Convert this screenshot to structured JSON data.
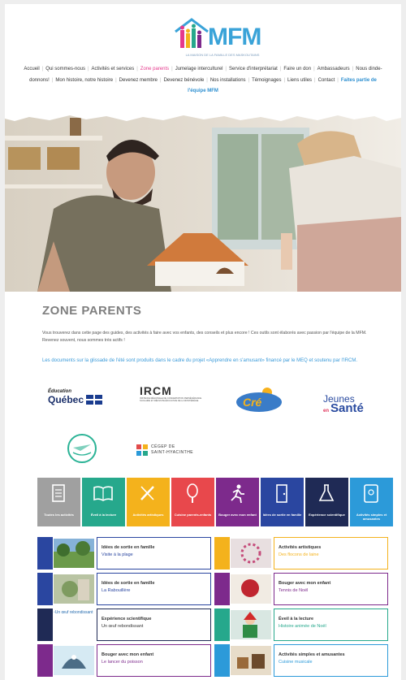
{
  "brand": {
    "logo_text": "MFM",
    "tagline": "LA MAISON DE LA FAMILLE DES MASKOUTAINS",
    "primary": "#3aa3d8",
    "accent": "#e5398c"
  },
  "nav": {
    "items": [
      {
        "label": "Accueil"
      },
      {
        "label": "Qui sommes-nous"
      },
      {
        "label": "Activités et services"
      },
      {
        "label": "Zone parents",
        "active": true
      },
      {
        "label": "Jumelage interculturel"
      },
      {
        "label": "Service d'interprétariat"
      },
      {
        "label": "Faire un don"
      },
      {
        "label": "Ambassadeurs"
      },
      {
        "label": "Nous dinde-donnons!"
      },
      {
        "label": "Mon histoire, notre histoire"
      },
      {
        "label": "Devenez membre"
      },
      {
        "label": "Devenez bénévole"
      },
      {
        "label": "Nos installations"
      },
      {
        "label": "Témoignages"
      },
      {
        "label": "Liens utiles"
      },
      {
        "label": "Contact"
      },
      {
        "label": "Faites partie de l'équipe MFM",
        "highlight": true
      }
    ]
  },
  "zone": {
    "title": "ZONE PARENTS",
    "intro": "Vous trouverez dans cette page des guides, des activités à faire avec vos enfants, des conseils et plus encore ! Ces outils sont élaborés avec passion par l'équipe de la MFM. Revenez souvent, nous sommes très actifs !",
    "docs_note": "Les documents sur la glissade de l'été sont produits dans le cadre du projet «Apprendre en s'amusant» financé par le MEQ et soutenu par l'IRCM."
  },
  "partners": {
    "quebec": {
      "top": "Éducation",
      "main": "Québec"
    },
    "ircm": {
      "name": "IRCM",
      "sub": "INSTANCE RÉGIONALE DE CONCERTATION PERSÉVÉRANCE SCOLAIRE ET RÉUSSITE ÉDUCATIVE DE LA MONTÉRÉGIE"
    },
    "cre": {
      "name": "Cré"
    },
    "jeunes": {
      "a": "Jeunes",
      "b": "en",
      "c": "Santé"
    },
    "cegep": {
      "l1": "CÉGEP DE",
      "l2": "SAINT-HYACINTHE"
    }
  },
  "categories": [
    {
      "label": "Toutes les activités",
      "color": "#a0a0a0",
      "icon": "list-document-icon"
    },
    {
      "label": "Éveil à la lecture",
      "color": "#26a88c",
      "icon": "open-book-icon"
    },
    {
      "label": "Activités artistiques",
      "color": "#f4b21c",
      "icon": "pencil-brush-icon"
    },
    {
      "label": "Cuisine parents-enfants",
      "color": "#e8484c",
      "icon": "whisk-icon"
    },
    {
      "label": "Bouger avec mon enfant",
      "color": "#7d2a8c",
      "icon": "running-person-icon"
    },
    {
      "label": "Idées de sortie en famille",
      "color": "#2a46a0",
      "icon": "door-icon"
    },
    {
      "label": "Expérience scientifique",
      "color": "#1f2a55",
      "icon": "flask-icon"
    },
    {
      "label": "Activités simples et amusantes",
      "color": "#2c9ad9",
      "icon": "tablet-icon"
    }
  ],
  "activities_left": [
    {
      "category": "Idées de sortie en famille",
      "title": "Visite à la plage",
      "color": "#2a46a0",
      "subcolor": "#2a46a0"
    },
    {
      "category": "Idées de sortie en famille",
      "title": "La Rabouillère",
      "color": "#2a46a0",
      "subcolor": "#2a46a0"
    },
    {
      "category": "Expérience scientifique",
      "title": "Un œuf rebondissant",
      "color": "#1f2a55",
      "subcolor": "#333",
      "thumb_alt": "Un œuf rebondissant"
    },
    {
      "category": "Bouger avec mon enfant",
      "title": "Le lancer du poisson",
      "color": "#7d2a8c",
      "subcolor": "#7d2a8c"
    }
  ],
  "activities_right": [
    {
      "category": "Activités artistiques",
      "title": "Des flocons de laine",
      "color": "#f4b21c",
      "subcolor": "#f4b21c"
    },
    {
      "category": "Bouger avec mon enfant",
      "title": "Tennis de Noël",
      "color": "#7d2a8c",
      "subcolor": "#7d2a8c"
    },
    {
      "category": "Éveil à la lecture",
      "title": "Histoire animée de Noël",
      "color": "#26a88c",
      "subcolor": "#26a88c"
    },
    {
      "category": "Activités simples et amusantes",
      "title": "Cuisine musicale",
      "color": "#2c9ad9",
      "subcolor": "#2c9ad9"
    }
  ]
}
